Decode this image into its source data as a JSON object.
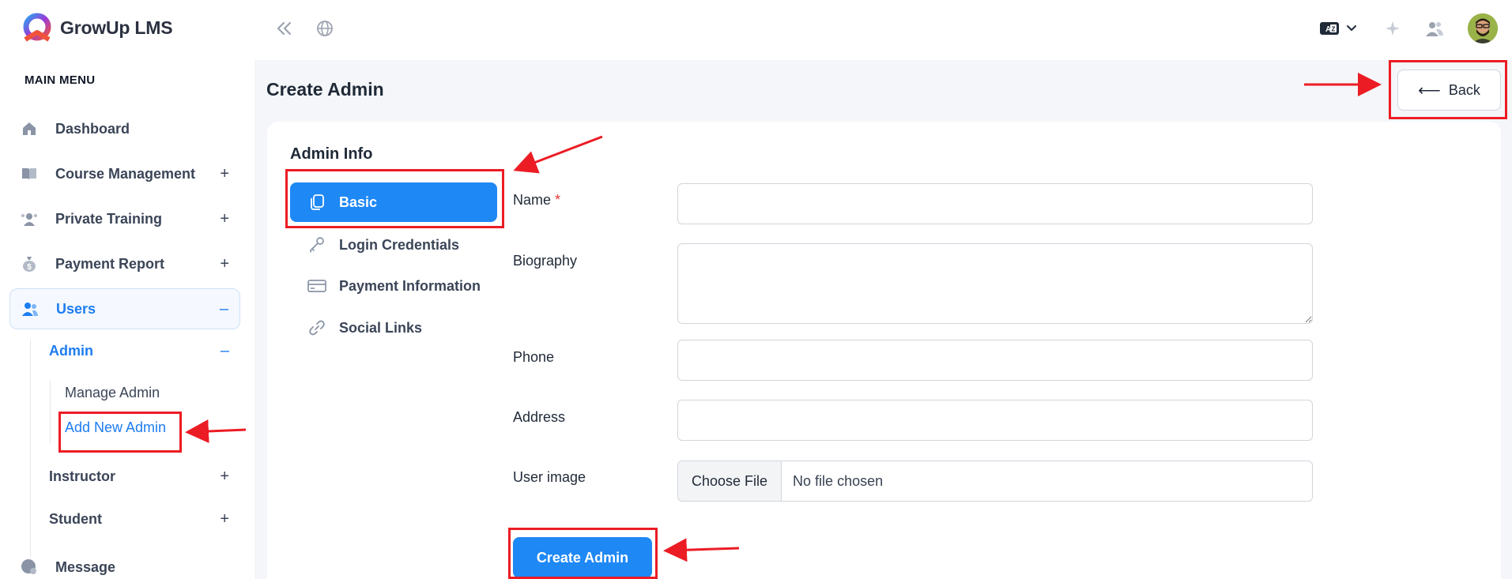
{
  "app": {
    "name": "GrowUp LMS"
  },
  "sidebar": {
    "menu_title": "MAIN MENU",
    "items": [
      {
        "label": "Dashboard",
        "icon": "home-icon",
        "sign": ""
      },
      {
        "label": "Course Management",
        "icon": "book-icon",
        "sign": "+"
      },
      {
        "label": "Private Training",
        "icon": "training-icon",
        "sign": "+"
      },
      {
        "label": "Payment Report",
        "icon": "money-bag-icon",
        "sign": "+"
      },
      {
        "label": "Users",
        "icon": "users-icon",
        "sign": "–"
      }
    ],
    "users_sub": [
      {
        "label": "Admin",
        "sign": "–"
      },
      {
        "label": "Instructor",
        "sign": "+"
      },
      {
        "label": "Student",
        "sign": "+"
      }
    ],
    "admin_sub": [
      {
        "label": "Manage Admin"
      },
      {
        "label": "Add New Admin"
      }
    ],
    "message": {
      "label": "Message",
      "icon": "message-icon"
    }
  },
  "topbar": {
    "icons": [
      "collapse-icon",
      "globe-icon",
      "language-icon",
      "chevron-down-icon",
      "sparkle-icon",
      "people-icon"
    ]
  },
  "main": {
    "title": "Create Admin",
    "back_label": "Back",
    "card_title": "Admin Info",
    "tabs": [
      {
        "label": "Basic",
        "icon": "copy-icon"
      },
      {
        "label": "Login Credentials",
        "icon": "key-icon"
      },
      {
        "label": "Payment Information",
        "icon": "card-icon"
      },
      {
        "label": "Social Links",
        "icon": "link-icon"
      }
    ],
    "fields": {
      "name": {
        "label": "Name",
        "required_mark": "*",
        "value": ""
      },
      "biography": {
        "label": "Biography",
        "value": ""
      },
      "phone": {
        "label": "Phone",
        "value": ""
      },
      "address": {
        "label": "Address",
        "value": ""
      },
      "user_image": {
        "label": "User image",
        "button": "Choose File",
        "status": "No file chosen"
      }
    },
    "submit_label": "Create Admin"
  },
  "colors": {
    "accent": "#1e88f5",
    "annotation": "#ec1c24"
  }
}
